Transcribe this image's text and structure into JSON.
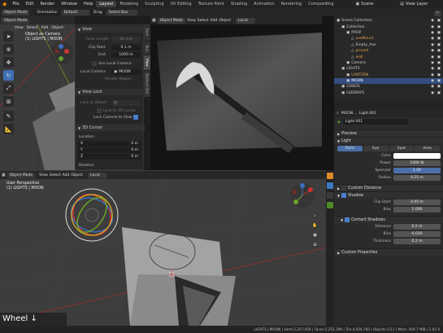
{
  "topbar": {
    "menus": [
      "File",
      "Edit",
      "Render",
      "Window",
      "Help"
    ],
    "workspaces": [
      "Layout",
      "Modeling",
      "Sculpting",
      "UV Editing",
      "Texture Paint",
      "Shading",
      "Animation",
      "Rendering",
      "Compositing"
    ],
    "active_workspace": "Layout",
    "scene": "Scene",
    "view_layer": "View Layer"
  },
  "tool_header": {
    "object_mode": "Object Mode",
    "orientation": "Orientation",
    "default": "Default",
    "drag": "Drag",
    "select_box": "Select Box"
  },
  "left_viewport": {
    "header": {
      "mode": "Object Mode",
      "view": "View",
      "select": "Select",
      "add": "Add",
      "object": "Object"
    },
    "overlay_title": "Object as Camera",
    "overlay_sub": "(1) LIGHTS | MOON"
  },
  "npanel": {
    "tabs": [
      "Item",
      "Tool",
      "View",
      "Shortcut VUr"
    ],
    "view_section": "View",
    "focal_length_label": "Focal Length",
    "focal_length_value": "50 mm",
    "clip_start_label": "Clip Start",
    "clip_start_value": "0.1 m",
    "end_label": "End",
    "end_value": "1000 m",
    "use_local_camera": "Use Local Camera",
    "local_camera_label": "Local Camera",
    "local_camera_value": "MOON",
    "render_region": "Render Region",
    "view_lock_section": "View Lock",
    "lock_to_object": "Lock to Object",
    "lock_to_3d_cursor": "Lock to 3D Cursor",
    "lock_camera_to_view": "Lock Camera to View",
    "cursor_section": "3D Cursor",
    "location_label": "Location",
    "cursor_x": "0 m",
    "cursor_y": "0 m",
    "cursor_z": "0 m",
    "axis_x": "X",
    "axis_y": "Y",
    "axis_z": "Z",
    "rotation_label": "Rotation"
  },
  "camera_view": {
    "header": {
      "mode": "Object Mode",
      "view": "View",
      "select": "Select",
      "add": "Add",
      "object": "Object",
      "transform": "Local"
    }
  },
  "bottom_viewport": {
    "header": {
      "mode": "Object Mode",
      "view": "View",
      "select": "Select",
      "add": "Add",
      "object": "Object",
      "transform": "Local"
    },
    "overlay_title": "User Perspective",
    "overlay_sub": "(1) LIGHTS | MOON",
    "wheel_label": "Wheel ↓"
  },
  "outliner": {
    "items": [
      {
        "name": "Scene Collection",
        "indent": 0,
        "color": "#cfcfcf"
      },
      {
        "name": "Collection",
        "indent": 1,
        "color": "#cfcfcf"
      },
      {
        "name": "PROP",
        "indent": 2,
        "color": "#cfcfcf"
      },
      {
        "name": "axeMount",
        "indent": 3,
        "color": "#e09a4a"
      },
      {
        "name": "Empty_Axe",
        "indent": 3,
        "color": "#cfcfcf"
      },
      {
        "name": "ground",
        "indent": 3,
        "color": "#e09a4a"
      },
      {
        "name": "wall",
        "indent": 3,
        "color": "#e09a4a"
      },
      {
        "name": "Camera",
        "indent": 2,
        "color": "#cfcfcf"
      },
      {
        "name": "LIGHTS",
        "indent": 1,
        "color": "#cfcfcf"
      },
      {
        "name": "LANTERN",
        "indent": 2,
        "color": "#d9a060"
      },
      {
        "name": "MOON",
        "indent": 2,
        "color": "#ffffff",
        "selected": true
      },
      {
        "name": "GOBOS",
        "indent": 1,
        "color": "#cfcfcf"
      },
      {
        "name": "GODRAYS",
        "indent": 1,
        "color": "#cfcfcf"
      }
    ]
  },
  "properties": {
    "object_name": "MOON",
    "data_name": "Light.001",
    "light_data_field": "Light.001",
    "preview": "Preview",
    "light": "Light",
    "light_types": [
      "Point",
      "Sun",
      "Spot",
      "Area"
    ],
    "active_type": "Point",
    "color_label": "Color",
    "color_value": "#ffffff",
    "power_label": "Power",
    "power_value": "1000 W",
    "specular_label": "Specular",
    "specular_value": "1.00",
    "radius_label": "Radius",
    "radius_value": "0.25 m",
    "custom_distance": "Custom Distance",
    "shadow": "Shadow",
    "clip_start_label": "Clip Start",
    "clip_start_value": "0.05 m",
    "bias_label": "Bias",
    "bias_value": "1.000",
    "contact_shadows": "Contact Shadows",
    "distance_label": "Distance",
    "distance_value": "0.2 m",
    "cs_bias_label": "Bias",
    "cs_bias_value": "0.030",
    "thickness_label": "Thickness",
    "thickness_value": "0.2 m",
    "custom_properties": "Custom Properties"
  },
  "status_bar": {
    "text": "LIGHTS | MOON | Verts:2,257,920 | Faces:2,252,396 | Tris:4,504,760 | Objects:1/11 | Mem: 509.7 MiB | 2.92.0"
  },
  "colors": {
    "accent": "#4a7fd0",
    "selected_row": "#334d80",
    "active_tab": "#4c6fa8"
  }
}
